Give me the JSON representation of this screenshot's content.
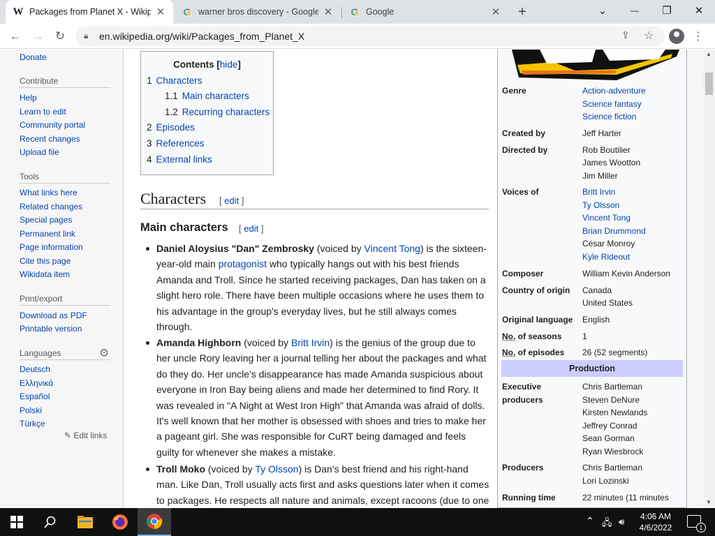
{
  "browser": {
    "tabs": [
      {
        "title": "Packages from Planet X - Wikipe",
        "favicon": "W",
        "close": "✕"
      },
      {
        "title": "warner bros discovery - Google S",
        "favicon": "G",
        "close": "✕"
      },
      {
        "title": "Google",
        "favicon": "G",
        "close": "✕"
      }
    ],
    "new_tab": "+",
    "url": "en.wikipedia.org/wiki/Packages_from_Planet_X",
    "window": {
      "chevron": "⌄",
      "minimize": "—",
      "restore": "❐",
      "close": "✕"
    }
  },
  "sidebar": {
    "top_link": "Donate",
    "sections": [
      {
        "heading": "Contribute",
        "links": [
          "Help",
          "Learn to edit",
          "Community portal",
          "Recent changes",
          "Upload file"
        ]
      },
      {
        "heading": "Tools",
        "links": [
          "What links here",
          "Related changes",
          "Special pages",
          "Permanent link",
          "Page information",
          "Cite this page",
          "Wikidata item"
        ]
      },
      {
        "heading": "Print/export",
        "links": [
          "Download as PDF",
          "Printable version"
        ]
      },
      {
        "heading": "Languages",
        "links": [
          "Deutsch",
          "Ελληνικά",
          "Español",
          "Polski",
          "Türkçe"
        ]
      }
    ],
    "edit_links": "Edit links"
  },
  "toc": {
    "title": "Contents",
    "hide": "hide",
    "items": [
      {
        "num": "1",
        "label": "Characters"
      },
      {
        "num": "1.1",
        "label": "Main characters"
      },
      {
        "num": "1.2",
        "label": "Recurring characters"
      },
      {
        "num": "2",
        "label": "Episodes"
      },
      {
        "num": "3",
        "label": "References"
      },
      {
        "num": "4",
        "label": "External links"
      }
    ]
  },
  "article": {
    "h2": "Characters",
    "h3": "Main characters",
    "edit": "edit",
    "items": [
      {
        "name": "Daniel Aloysius \"Dan\" Zembrosky",
        "pre": " (voiced by ",
        "link": "Vincent Tong",
        "mid": ") is the sixteen-year-old main ",
        "link2": "protagonist",
        "rest": " who typically hangs out with his best friends Amanda and Troll. Since he started receiving packages, Dan has taken on a slight hero role. There have been multiple occasions where he uses them to his advantage in the group's everyday lives, but he still always comes through."
      },
      {
        "name": "Amanda Highborn",
        "pre": " (voiced by ",
        "link": "Britt Irvin",
        "rest": ") is the genius of the group due to her uncle Rory leaving her a journal telling her about the packages and what do they do. Her uncle's disappearance has made Amanda suspicious about everyone in Iron Bay being aliens and made her determined to find Rory. It was revealed in \"A Night at West Iron High\" that Amanda was afraid of dolls. It's well known that her mother is obsessed with shoes and tries to make her a pageant girl. She was responsible for CuRT being damaged and feels guilty for whenever she makes a mistake."
      },
      {
        "name": "Troll Moko",
        "pre": " (voiced by ",
        "link": "Ty Olsson",
        "rest": ") is Dan's best friend and his right-hand man. Like Dan, Troll usually acts first and asks questions later when it comes to packages. He respects all nature and animals, except racoons (due to one"
      }
    ]
  },
  "infobox": {
    "rows": [
      {
        "label": "Genre",
        "values": [
          "Action-adventure",
          "Science fantasy",
          "Science fiction"
        ],
        "links": true
      },
      {
        "label": "Created by",
        "values": [
          "Jeff Harter"
        ],
        "links": false
      },
      {
        "label": "Directed by",
        "values": [
          "Rob Boutilier",
          "James Wootton",
          "Jim Miller"
        ],
        "links": false
      },
      {
        "label": "Voices of",
        "values": [
          "Britt Irvin",
          "Ty Olsson",
          "Vincent Tong",
          "Brian Drummond",
          "César Monroy",
          "Kyle Rideout"
        ],
        "links": [
          true,
          true,
          true,
          true,
          false,
          true
        ]
      },
      {
        "label": "Composer",
        "values": [
          "William Kevin Anderson"
        ],
        "links": false
      },
      {
        "label": "Country of origin",
        "values": [
          "Canada",
          "United States"
        ],
        "links": false
      },
      {
        "label": "Original language",
        "values": [
          "English"
        ],
        "links": false
      },
      {
        "label": "No. of seasons",
        "values": [
          "1"
        ],
        "links": false
      },
      {
        "label": "No. of episodes",
        "values": [
          "26 (52 segments)"
        ],
        "links": false
      }
    ],
    "production_heading": "Production",
    "production_rows": [
      {
        "label": "Executive producers",
        "values": [
          "Chris Bartleman",
          "Steven DeNure",
          "Kirsten Newlands",
          "Jeffrey Conrad",
          "Sean Gorman",
          "Ryan Wiesbrock"
        ]
      },
      {
        "label": "Producers",
        "values": [
          "Chris Bartleman",
          "Lori Lozinski"
        ]
      },
      {
        "label": "Running time",
        "values": [
          "22 minutes (11 minutes"
        ]
      }
    ]
  },
  "taskbar": {
    "time": "4:06 AM",
    "date": "4/6/2022",
    "notifications": "1"
  },
  "colors": {
    "link": "#0645ad",
    "production_band": "#ccccff",
    "taskbar": "#101010"
  }
}
